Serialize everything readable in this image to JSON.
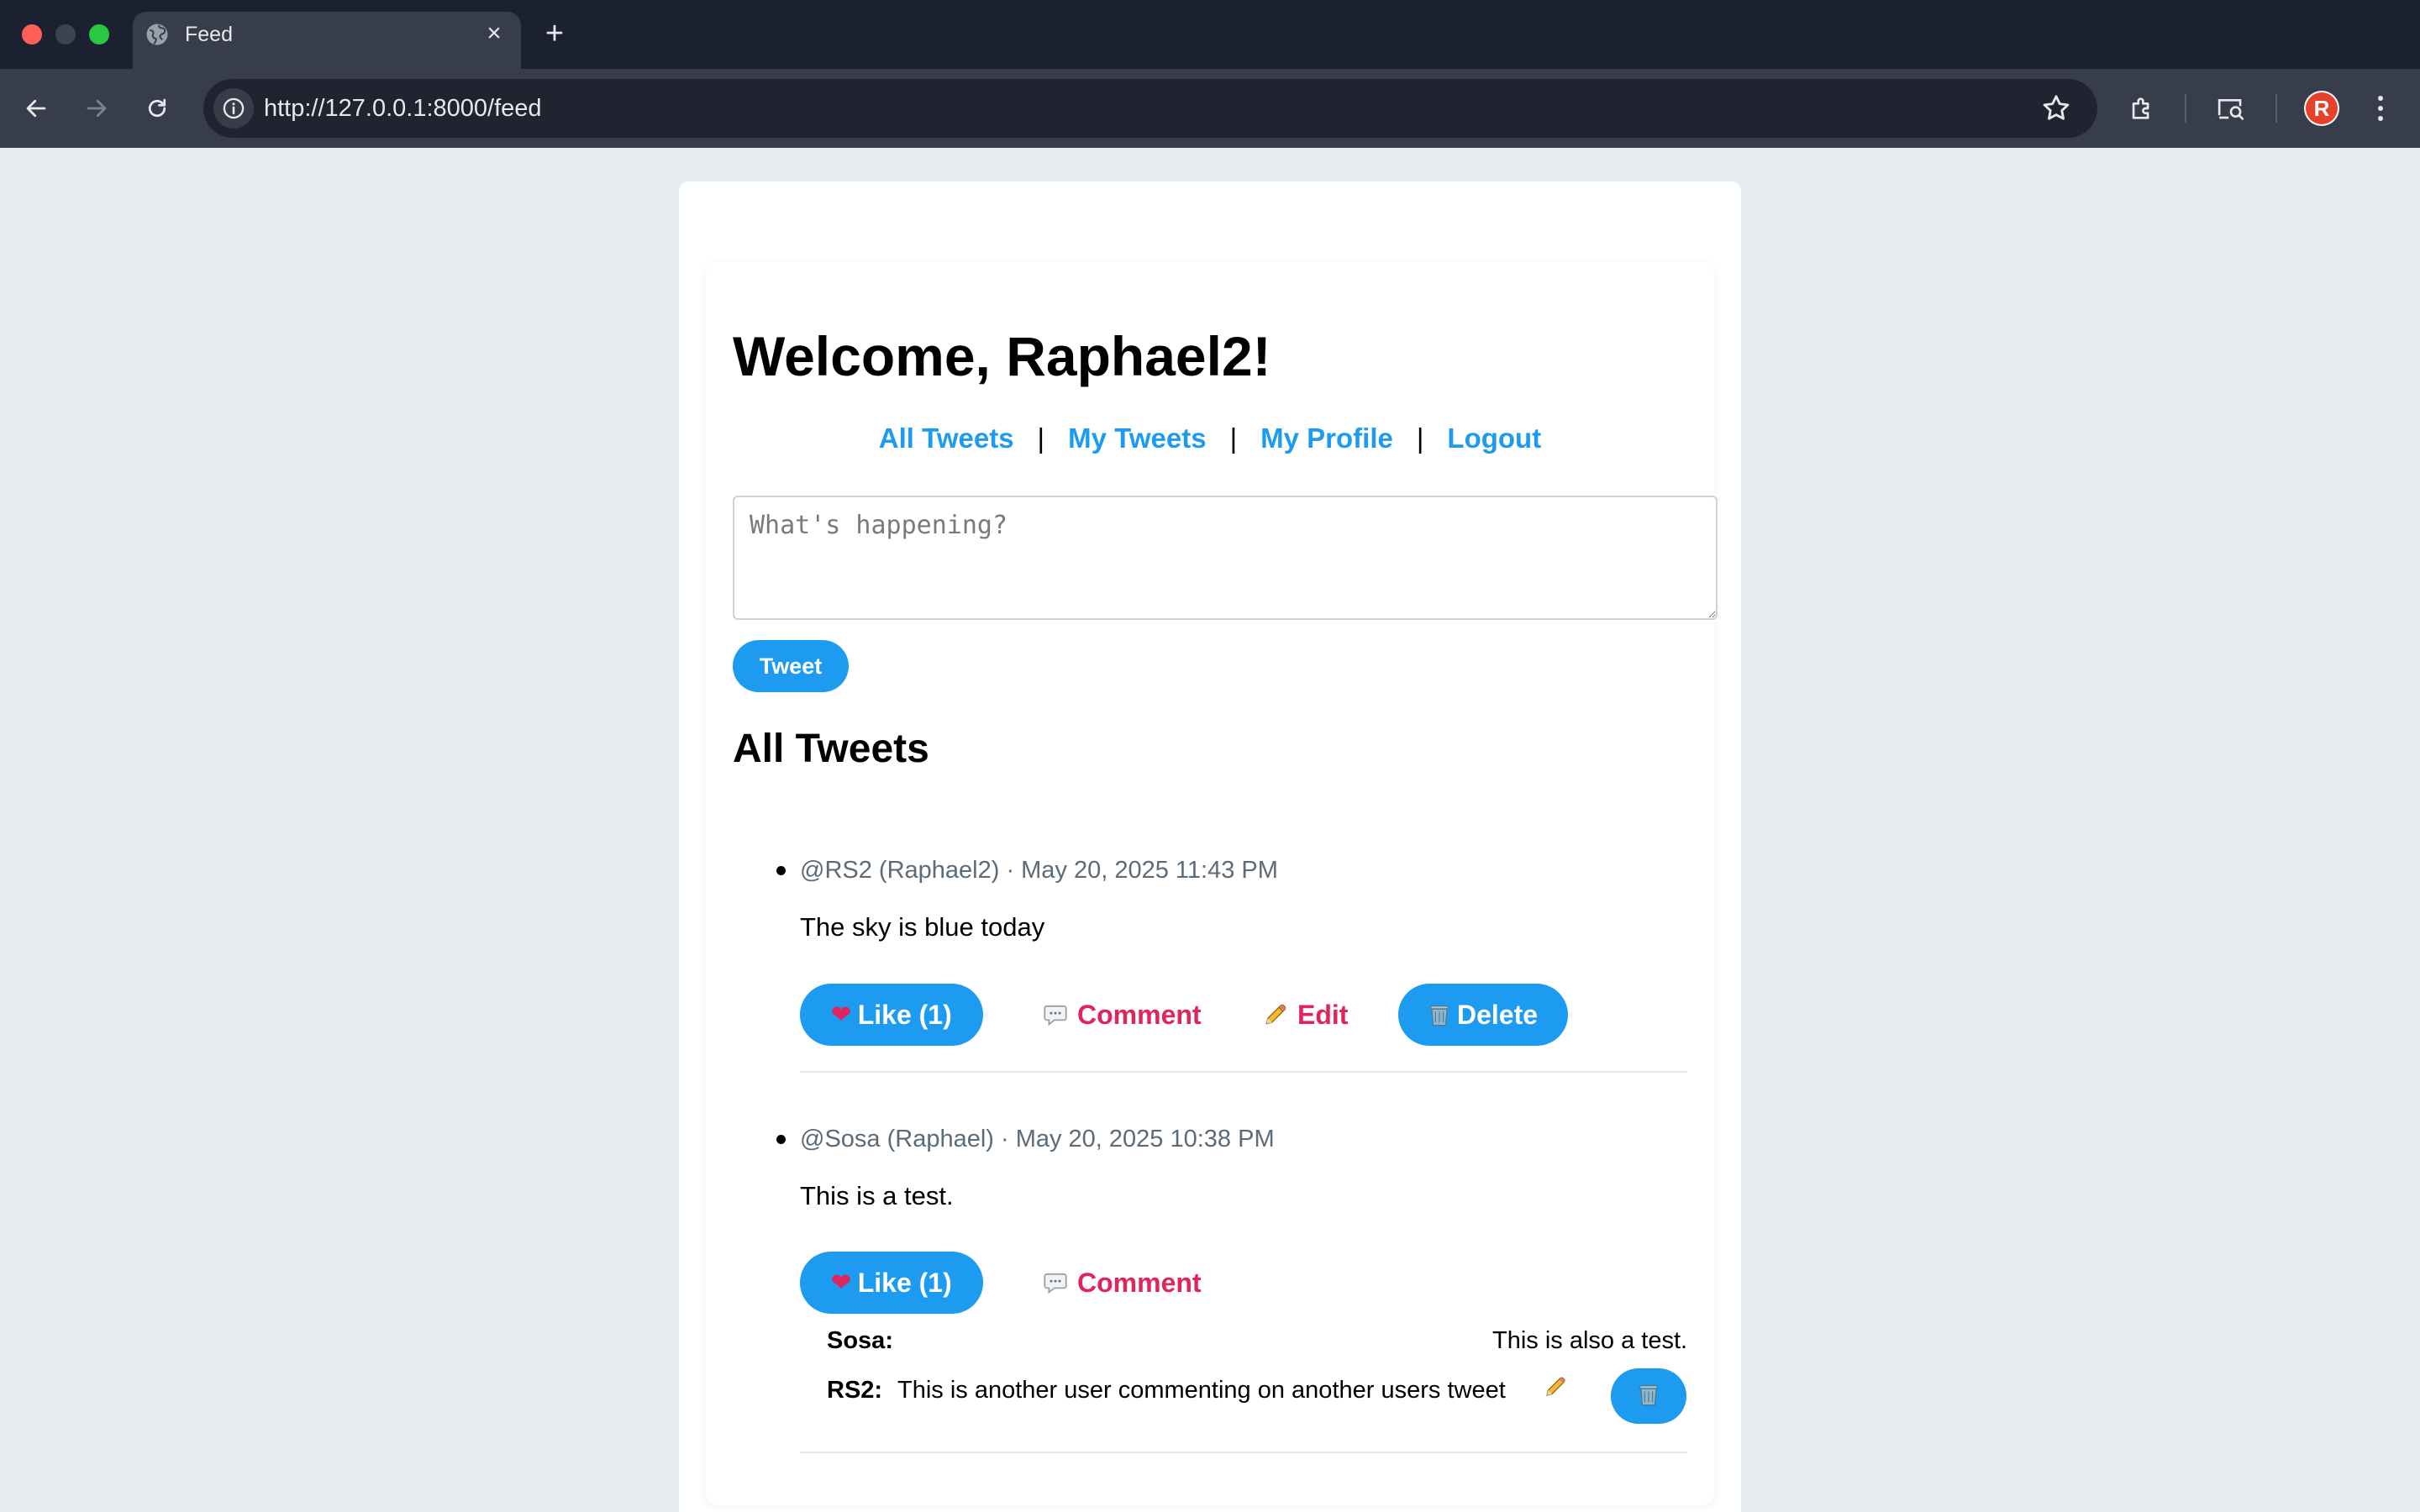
{
  "browser": {
    "tab_title": "Feed",
    "url": "http://127.0.0.1:8000/feed",
    "profile_initial": "R",
    "icons": [
      "globe-icon",
      "close-icon",
      "plus-icon",
      "back-icon",
      "forward-icon",
      "reload-icon",
      "info-icon",
      "star-icon",
      "extensions-icon",
      "cast-search-icon",
      "avatar",
      "more-icon"
    ]
  },
  "page": {
    "welcome": "Welcome, Raphael2!",
    "nav": [
      {
        "label": "All Tweets"
      },
      {
        "label": "My Tweets"
      },
      {
        "label": "My Profile"
      },
      {
        "label": "Logout"
      }
    ],
    "nav_separator": "|",
    "compose_placeholder": "What's happening?",
    "compose_value": "",
    "tweet_button": "Tweet",
    "section_title": "All Tweets"
  },
  "tweets": [
    {
      "meta": "@RS2 (Raphael2) · May 20, 2025 11:43 PM",
      "text": "The sky is blue today",
      "like_label": "Like (1)",
      "comment_label": "Comment",
      "edit_label": "Edit",
      "delete_label": "Delete",
      "comments": []
    },
    {
      "meta": "@Sosa (Raphael) · May 20, 2025 10:38 PM",
      "text": "This is a test.",
      "like_label": "Like (1)",
      "comment_label": "Comment",
      "comments": [
        {
          "author": "Sosa:",
          "text": "This is also a test."
        },
        {
          "author": "RS2:",
          "text": "This is another user commenting on another users tweet"
        }
      ]
    }
  ],
  "colors": {
    "accent": "#1d9bf0",
    "action_pink": "#e0245e",
    "meta_gray": "#5b6b78",
    "page_bg": "#e6ebef"
  }
}
